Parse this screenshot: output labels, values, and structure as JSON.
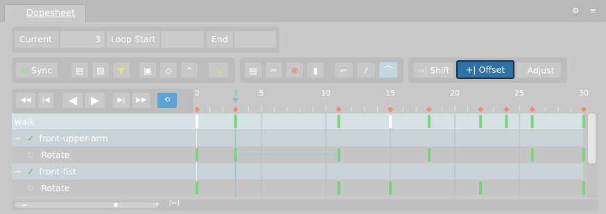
{
  "panel": {
    "tab_label": "Dopesheet",
    "tab_icon": "dopesheet-icon",
    "tools": "⚙ ≡"
  },
  "fields": {
    "current_label": "Current",
    "current_value": "3",
    "loop_start_label": "Loop Start",
    "loop_start_value": "",
    "end_label": "End",
    "end_value": ""
  },
  "toolbar": {
    "sync_label": "Sync",
    "shift_label": "Shift",
    "offset_label": "Offset",
    "adjust_label": "Adjust"
  },
  "ruler": {
    "ticks": [
      "0",
      "3",
      "5",
      "10",
      "15",
      "20",
      "25",
      "30"
    ],
    "current_frame": 3
  },
  "tracks": [
    {
      "label": "walk",
      "kind": "skeleton"
    },
    {
      "label": "front-upper-arm",
      "kind": "bone",
      "expanded": true,
      "checked": true
    },
    {
      "label": "Rotate",
      "kind": "timeline"
    },
    {
      "label": "front-fist",
      "kind": "bone",
      "expanded": true,
      "checked": true
    },
    {
      "label": "Rotate",
      "kind": "timeline"
    }
  ],
  "keys": {
    "summary": [
      0,
      3,
      11,
      15,
      18,
      22,
      24,
      26,
      30
    ],
    "upper_arm_rotate": [
      0,
      3,
      11,
      18,
      26,
      30
    ],
    "fist_rotate": [
      0,
      11,
      15,
      22,
      30
    ]
  },
  "colors": {
    "accent": "#2f72a6",
    "loop_active": "#5aa5d6",
    "key_marker": "#f08a78",
    "playhead": "#67c7e0",
    "key_green": "#79d379"
  }
}
